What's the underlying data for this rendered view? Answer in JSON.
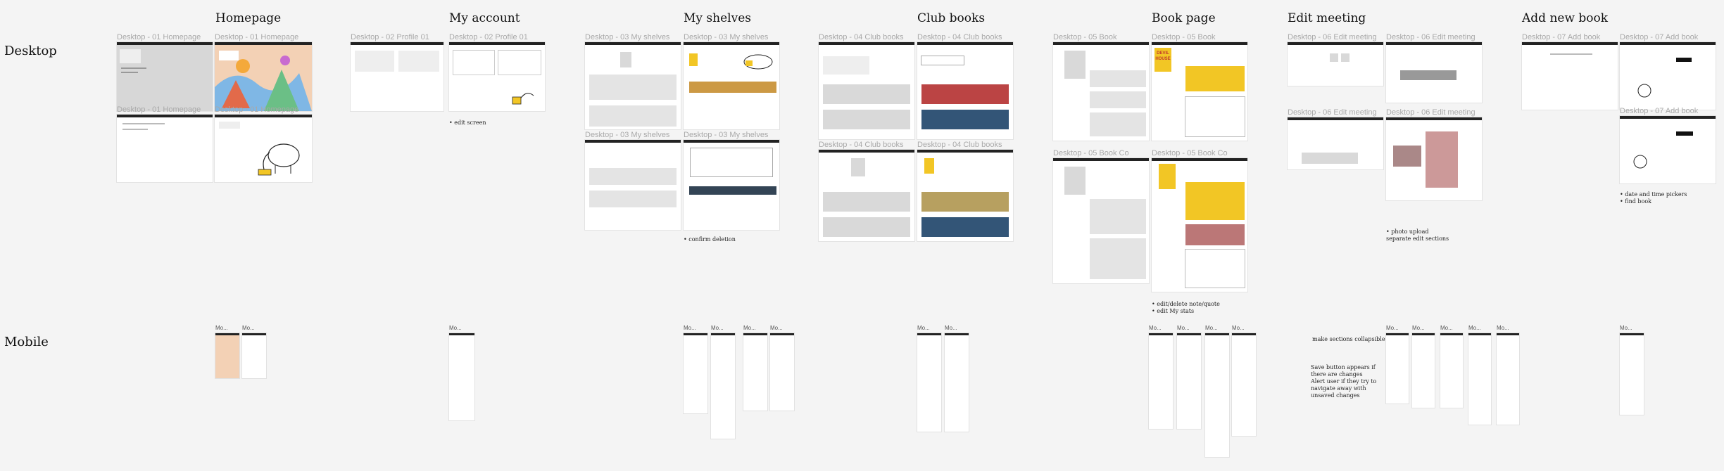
{
  "sections": {
    "homepage": "Homepage",
    "my_account": "My account",
    "my_shelves": "My shelves",
    "club_books": "Club books",
    "book_page": "Book page",
    "edit_meeting": "Edit meeting",
    "add_new_book": "Add new book"
  },
  "rows": {
    "desktop": "Desktop",
    "mobile": "Mobile"
  },
  "frame_labels": {
    "home_1": "Desktop - 01 Homepage",
    "home_2": "Desktop - 01 Homepage",
    "home_3": "Desktop - 01 Homepage",
    "home_4": "Desktop - 01 Homepage",
    "profile_1": "Desktop - 02 Profile 01",
    "profile_2": "Desktop - 02 Profile 01",
    "shelves_1": "Desktop - 03 My shelves",
    "shelves_2": "Desktop - 03 My shelves",
    "shelves_3": "Desktop - 03 My shelves",
    "shelves_4": "Desktop - 03 My shelves",
    "club_1": "Desktop - 04 Club books",
    "club_2": "Desktop - 04 Club books",
    "club_3": "Desktop - 04 Club books",
    "club_4": "Desktop - 04 Club books",
    "book_1": "Desktop - 05 Book",
    "book_2": "Desktop - 05 Book",
    "book_3": "Desktop - 05 Book Co",
    "book_4": "Desktop - 05 Book Co",
    "meet_1": "Desktop - 06 Edit meeting",
    "meet_2": "Desktop - 06 Edit meeting",
    "meet_3": "Desktop - 06 Edit meeting",
    "meet_4": "Desktop - 06 Edit meeting",
    "add_1": "Desktop - 07 Add book",
    "add_2": "Desktop - 07 Add book",
    "add_3": "Desktop - 07 Add book",
    "mobile_short": "Mo..."
  },
  "notes": {
    "edit_screen": "• edit screen",
    "confirm_deletion": "• confirm deletion",
    "edit_delete_note": "• edit/delete note/quote\n• edit My stats",
    "photo_upload": "• photo upload\nseparate edit sections",
    "date_time": "• date and time pickers\n• find book",
    "collapsible": "make sections collapsible?",
    "save_button": "Save button appears if\nthere are changes\nAlert user if they try to\nnavigate away with\nunsaved changes"
  },
  "book_cover": {
    "title_line_1": "DEVIL",
    "title_line_2": "HOUSE"
  },
  "colors": {
    "background": "#f4f4f4",
    "frame": "#ffffff",
    "placeholder": "#d9d9d9",
    "accent_yellow": "#f2c625",
    "topbar": "#222222"
  }
}
